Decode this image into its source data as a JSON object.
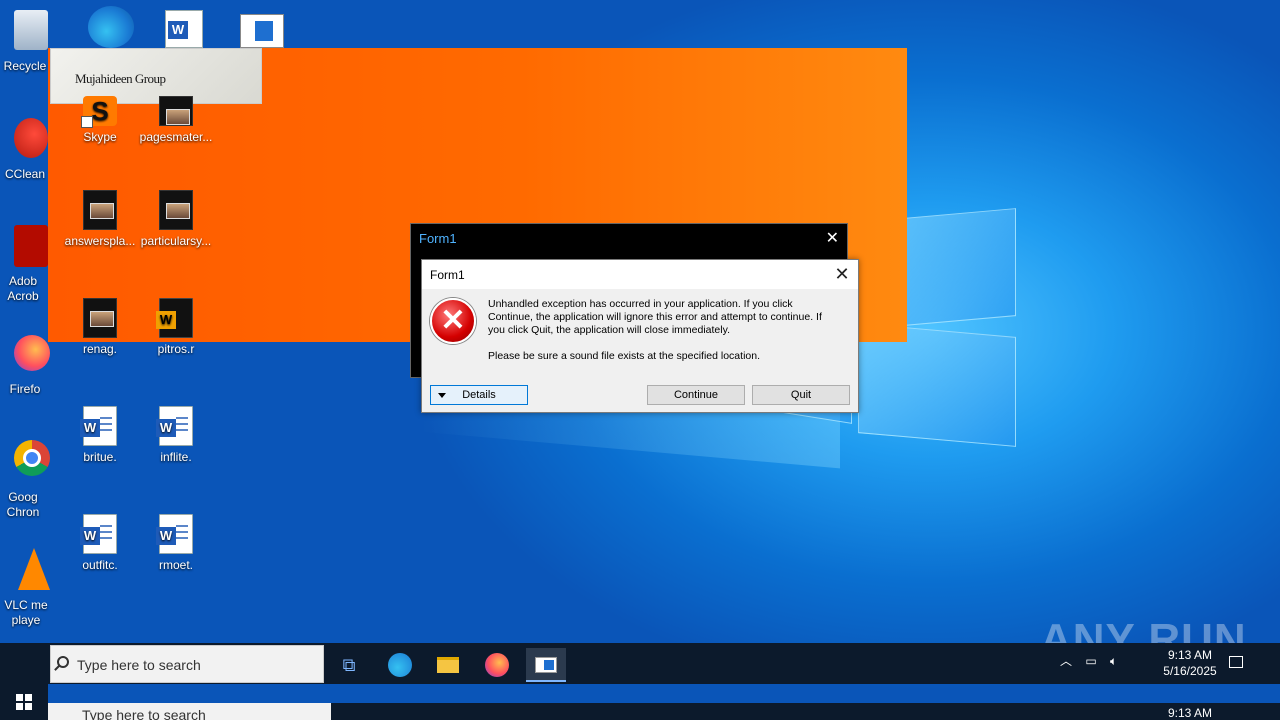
{
  "desktop": {
    "left_column": [
      {
        "label": "Recycle",
        "icon": "recycle-bin-icon"
      },
      {
        "label": "CClean",
        "icon": "ccleaner-icon"
      },
      {
        "label": "Adob Acrob",
        "icon": "acrobat-icon"
      },
      {
        "label": "Firefo",
        "icon": "firefox-icon"
      },
      {
        "label": "Goog Chron",
        "icon": "chrome-icon"
      },
      {
        "label": "VLC me playe",
        "icon": "vlc-icon"
      }
    ],
    "icons": [
      {
        "label": "Skype",
        "icon": "skype-icon"
      },
      {
        "label": "pagesmater...",
        "icon": "video-file-icon"
      },
      {
        "label": "answerspla...",
        "icon": "video-file-icon"
      },
      {
        "label": "particularsy...",
        "icon": "video-file-icon"
      },
      {
        "label": "renag.",
        "icon": "video-file-icon"
      },
      {
        "label": "pitros.r",
        "icon": "word-doc-icon"
      },
      {
        "label": "britue.",
        "icon": "word-doc-icon"
      },
      {
        "label": "inflite.",
        "icon": "word-doc-icon"
      },
      {
        "label": "outfitc.",
        "icon": "word-doc-icon"
      },
      {
        "label": "rmoet.",
        "icon": "word-doc-icon"
      }
    ]
  },
  "overlay": {
    "logo_text": "Mujahideen Group",
    "background_form_title": "Form1",
    "background_form_close": "✕"
  },
  "dialog": {
    "title": "Form1",
    "close_glyph": "✕",
    "error_glyph": "✕",
    "message_1": "Unhandled exception has occurred in your application. If you click Continue, the application will ignore this error and attempt to continue. If you click Quit, the application will close immediately.",
    "message_2": "Please be sure a sound file exists at the specified location.",
    "details_label": "Details",
    "continue_label": "Continue",
    "quit_label": "Quit"
  },
  "taskbar": {
    "search_placeholder": "Type here to search",
    "time": "9:13 AM",
    "date": "5/16/2025",
    "items": [
      {
        "name": "task-view-icon",
        "glyph": "⧉"
      },
      {
        "name": "edge-icon",
        "glyph": "◉"
      },
      {
        "name": "file-explorer-icon",
        "glyph": "▬"
      },
      {
        "name": "firefox-icon",
        "glyph": "●"
      },
      {
        "name": "app-window-icon",
        "glyph": "▣"
      }
    ],
    "ghost_search": "Type here to search",
    "ghost_time": "9:13 AM"
  },
  "watermark": "ANY RUN",
  "colors": {
    "accent": "#0078d7",
    "overlay_orange": "#ff6a00",
    "taskbar": "#0c1a2c"
  }
}
